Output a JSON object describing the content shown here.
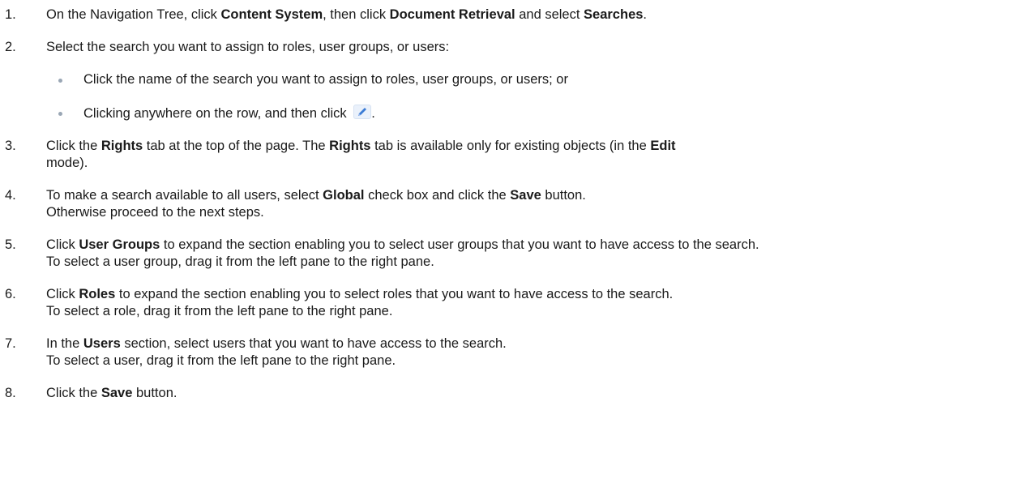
{
  "steps": [
    {
      "num": "1.",
      "parts": [
        "On the Navigation Tree, click ",
        "Content System",
        ", then click ",
        "Document Retrieval",
        " and select ",
        "Searches",
        "."
      ]
    },
    {
      "num": "2.",
      "text": "Select the search you want to assign to roles, user groups, or users:",
      "substeps": [
        "Click the name of the search you want to assign to roles, user groups, or users; or",
        "Clicking anywhere on the row, and then click"
      ],
      "substep_tail": "."
    },
    {
      "num": "3.",
      "parts": [
        "Click the ",
        "Rights",
        " tab at the top of the page. The ",
        "Rights",
        " tab is available only for existing objects (in the ",
        "Edit",
        " mode)."
      ]
    },
    {
      "num": "4.",
      "parts": [
        "To make a search available to all users, select ",
        "Global",
        " check box and click the ",
        "Save",
        " button."
      ],
      "line2": "Otherwise proceed to the next steps."
    },
    {
      "num": "5.",
      "parts": [
        "Click ",
        "User Groups",
        " to expand the section enabling you to select user groups that you want to have access to the search."
      ],
      "line2": "To select a user group, drag it from the left pane to the right pane."
    },
    {
      "num": "6.",
      "parts": [
        "Click ",
        "Roles",
        " to expand the section enabling you to select roles that you want to have access to the search."
      ],
      "line2": "To select a role, drag it from the left pane to the right pane."
    },
    {
      "num": "7.",
      "parts": [
        "In the ",
        "Users",
        " section, select users that you want to have access to the search."
      ],
      "line2": "To select a user, drag it from the left pane to the right pane."
    },
    {
      "num": "8.",
      "parts": [
        "Click the ",
        "Save",
        " button."
      ]
    }
  ],
  "icons": {
    "edit": "pencil-icon"
  },
  "colors": {
    "text": "#1a1a1a",
    "bullet": "#9aa7b5",
    "pencil": "#3a7bd5"
  }
}
